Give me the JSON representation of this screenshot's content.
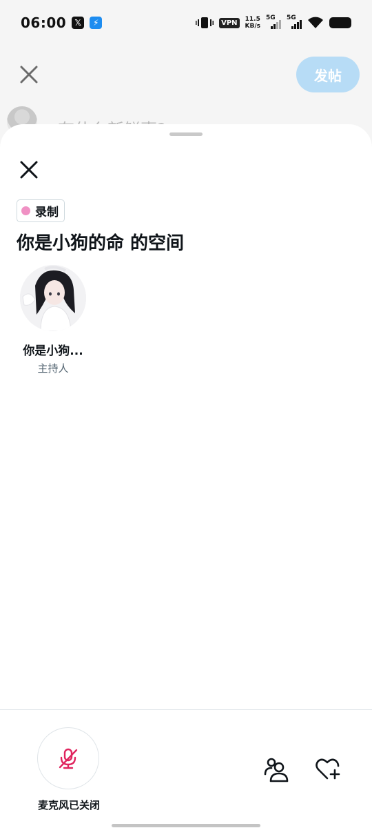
{
  "status_bar": {
    "time": "06:00",
    "vpn": "VPN",
    "speed_value": "11.5",
    "speed_unit": "KB/s",
    "sim1": "5G",
    "sim2": "5G",
    "apps": [
      "x-icon",
      "bolt-icon"
    ]
  },
  "compose": {
    "post_label": "发帖",
    "placeholder": "有什么新鲜事?",
    "post_color": "#b7dcf6"
  },
  "space": {
    "record_label": "录制",
    "record_dot_color": "#f091c4",
    "title": "你是小狗的命 的空间",
    "host": {
      "name": "你是小狗...",
      "role": "主持人"
    }
  },
  "controls": {
    "mic_label": "麦克风已关闭",
    "mic_icon_color": "#e0245e",
    "icons": [
      "mic-off-icon",
      "people-icon",
      "heart-plus-icon"
    ]
  }
}
